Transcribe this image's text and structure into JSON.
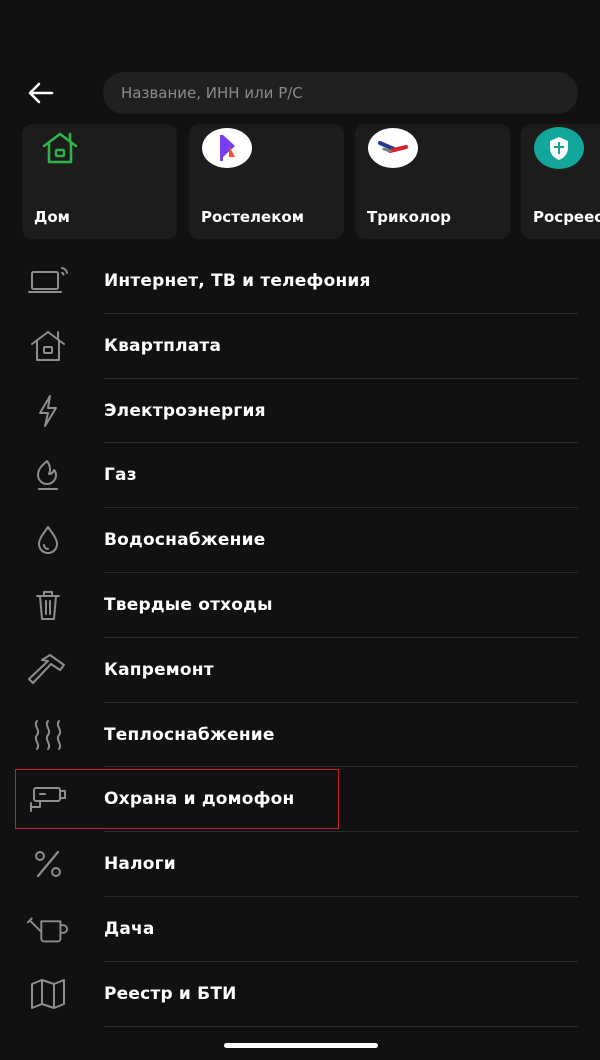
{
  "search": {
    "placeholder": "Название, ИНН или Р/С"
  },
  "colors": {
    "background": "#111111",
    "card": "#1c1c1c",
    "highlight": "#c0222a",
    "home_icon": "#2fb34a",
    "rostelecom": "#7a3cf0"
  },
  "cards": [
    {
      "label": "Дом",
      "icon": "house-icon"
    },
    {
      "label": "Ростелеком",
      "icon": "rostelecom-logo"
    },
    {
      "label": "Триколор",
      "icon": "tricolor-logo"
    },
    {
      "label": "Росреес",
      "icon": "rosreestr-logo"
    }
  ],
  "categories": [
    {
      "label": "Интернет, ТВ и телефония",
      "icon": "laptop-icon"
    },
    {
      "label": "Квартплата",
      "icon": "house-icon"
    },
    {
      "label": "Электроэнергия",
      "icon": "lightning-icon"
    },
    {
      "label": "Газ",
      "icon": "flame-icon"
    },
    {
      "label": "Водоснабжение",
      "icon": "water-drop-icon"
    },
    {
      "label": "Твердые отходы",
      "icon": "trash-icon"
    },
    {
      "label": "Капремонт",
      "icon": "hammer-icon"
    },
    {
      "label": "Теплоснабжение",
      "icon": "heat-waves-icon"
    },
    {
      "label": "Охрана и домофон",
      "icon": "security-camera-icon",
      "highlighted": true
    },
    {
      "label": "Налоги",
      "icon": "percent-icon"
    },
    {
      "label": "Дача",
      "icon": "watering-can-icon"
    },
    {
      "label": "Реестр и БТИ",
      "icon": "map-icon"
    }
  ]
}
